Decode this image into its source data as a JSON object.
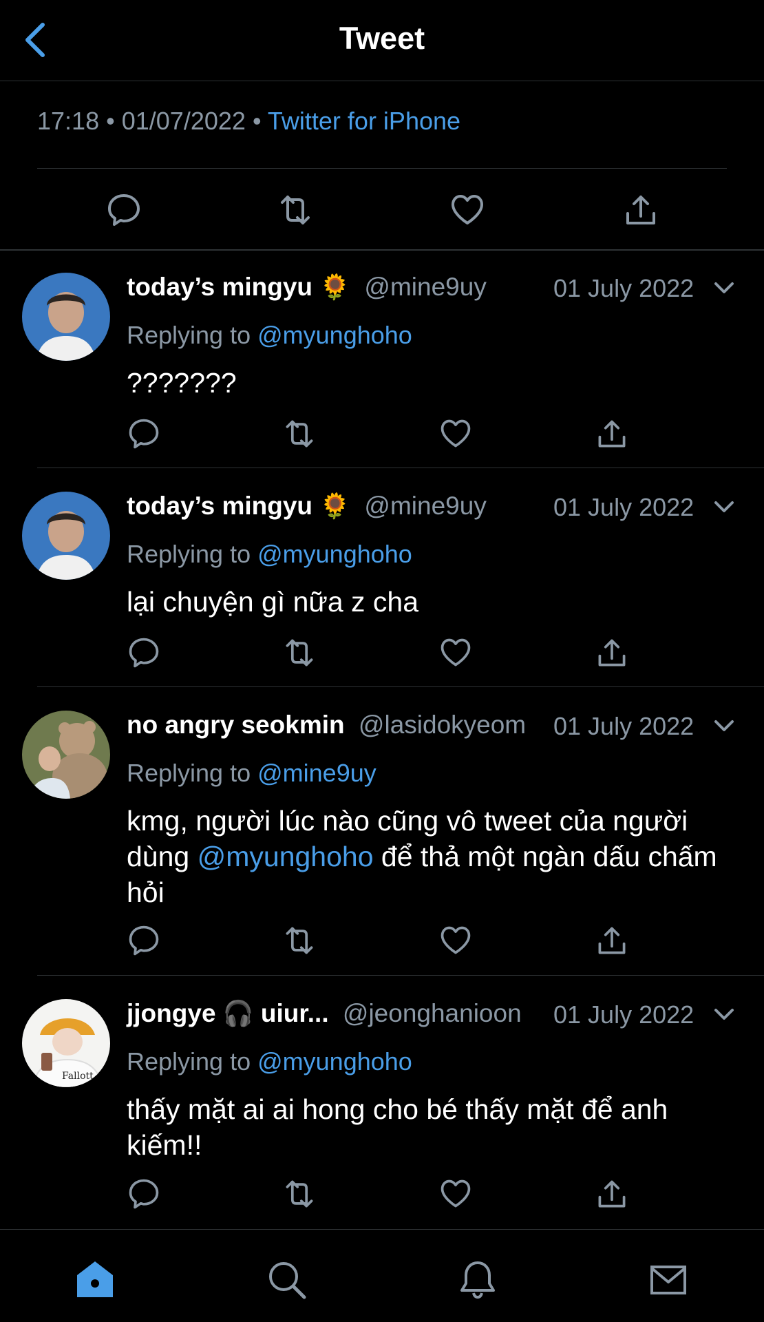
{
  "header": {
    "title": "Tweet"
  },
  "meta": {
    "time": "17:18",
    "date": "01/07/2022",
    "separator": "•",
    "source": "Twitter for iPhone"
  },
  "colors": {
    "accent": "#4a9ee8",
    "muted": "#8b98a5",
    "divider": "#2f3336"
  },
  "replies": [
    {
      "name": "today’s mingyu",
      "emoji": "🌻",
      "handle": "@mine9uy",
      "date": "01 July 2022",
      "replying_prefix": "Replying to",
      "replying_to": "@myunghoho",
      "text": "???????"
    },
    {
      "name": "today’s mingyu",
      "emoji": "🌻",
      "handle": "@mine9uy",
      "date": "01 July 2022",
      "replying_prefix": "Replying to",
      "replying_to": "@myunghoho",
      "text": "lại chuyện gì nữa z cha"
    },
    {
      "name": "no angry seokmin",
      "emoji": "",
      "handle": "@lasidokyeom",
      "date": "01 July 2022",
      "replying_prefix": "Replying to",
      "replying_to": "@mine9uy",
      "text_before": "kmg, người lúc nào cũng vô tweet của người dùng",
      "text_mention": "@myunghoho",
      "text_after": "để thả một ngàn dấu chấm hỏi"
    },
    {
      "name": "jjongye",
      "emoji": "🎧",
      "name_suffix": "uiur...",
      "handle": "@jeonghanioon",
      "date": "01 July 2022",
      "replying_prefix": "Replying to",
      "replying_to": "@myunghoho",
      "text": "thấy mặt ai ai hong cho bé thấy mặt để anh kiếm!!"
    }
  ],
  "icons": {
    "reply": "speech-bubble-icon",
    "retweet": "retweet-icon",
    "like": "heart-icon",
    "share": "share-icon",
    "tabs": [
      "home-icon",
      "search-icon",
      "bell-icon",
      "mail-icon"
    ]
  }
}
